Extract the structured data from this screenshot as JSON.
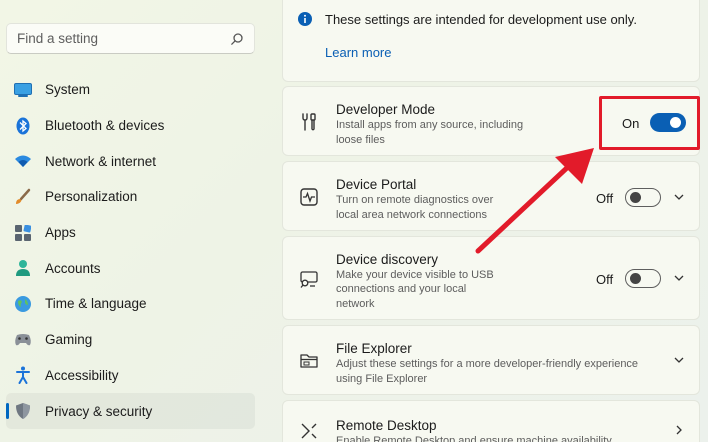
{
  "sidebar": {
    "search_placeholder": "Find a setting",
    "items": [
      {
        "label": "System",
        "icon": "system-icon",
        "active": false
      },
      {
        "label": "Bluetooth & devices",
        "icon": "bluetooth-icon",
        "active": false
      },
      {
        "label": "Network & internet",
        "icon": "wifi-icon",
        "active": false
      },
      {
        "label": "Personalization",
        "icon": "brush-icon",
        "active": false
      },
      {
        "label": "Apps",
        "icon": "apps-icon",
        "active": false
      },
      {
        "label": "Accounts",
        "icon": "person-icon",
        "active": false
      },
      {
        "label": "Time & language",
        "icon": "globe-icon",
        "active": false
      },
      {
        "label": "Gaming",
        "icon": "gamepad-icon",
        "active": false
      },
      {
        "label": "Accessibility",
        "icon": "accessibility-icon",
        "active": false
      },
      {
        "label": "Privacy & security",
        "icon": "shield-icon",
        "active": true
      }
    ]
  },
  "info": {
    "text": "These settings are intended for development use only.",
    "link": "Learn more"
  },
  "settings": {
    "developer_mode": {
      "title": "Developer Mode",
      "desc1": "Install apps from any source, including",
      "desc2": "loose files",
      "state": "On"
    },
    "device_portal": {
      "title": "Device Portal",
      "desc1": "Turn on remote diagnostics over",
      "desc2": "local area network connections",
      "state": "Off"
    },
    "device_discovery": {
      "title": "Device discovery",
      "desc1": "Make your device visible to USB",
      "desc2": "connections and your local",
      "desc3": "network",
      "state": "Off"
    },
    "file_explorer": {
      "title": "File Explorer",
      "desc1": "Adjust these settings for a more developer-friendly experience",
      "desc2": "using File Explorer"
    },
    "remote_desktop": {
      "title": "Remote Desktop",
      "desc1": "Enable Remote Desktop and ensure machine availability"
    }
  },
  "colors": {
    "accent": "#0a5fb4",
    "annotation": "#e21b2a"
  }
}
